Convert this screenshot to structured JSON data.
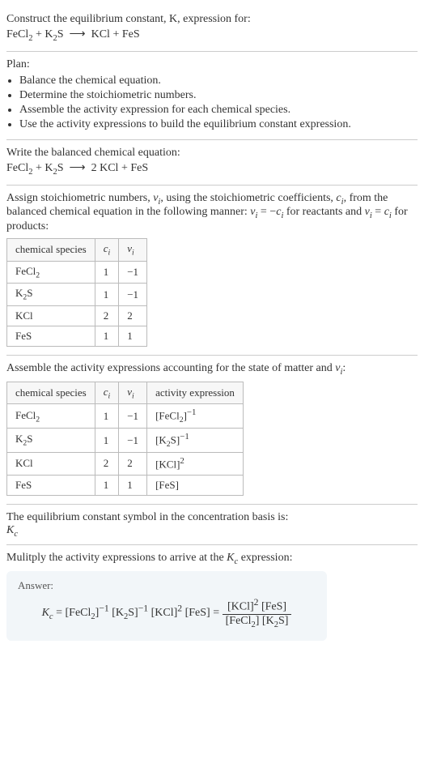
{
  "prompt": {
    "line1": "Construct the equilibrium constant, K, expression for:",
    "equation_unbalanced_html": "FeCl<sub>2</sub> + K<sub>2</sub>S &nbsp;⟶&nbsp; KCl + FeS"
  },
  "plan": {
    "heading": "Plan:",
    "items": [
      "Balance the chemical equation.",
      "Determine the stoichiometric numbers.",
      "Assemble the activity expression for each chemical species.",
      "Use the activity expressions to build the equilibrium constant expression."
    ]
  },
  "balanced": {
    "heading": "Write the balanced chemical equation:",
    "equation_html": "FeCl<sub>2</sub> + K<sub>2</sub>S &nbsp;⟶&nbsp; 2 KCl + FeS"
  },
  "stoich": {
    "intro_html": "Assign stoichiometric numbers, <i>ν<sub>i</sub></i>, using the stoichiometric coefficients, <i>c<sub>i</sub></i>, from the balanced chemical equation in the following manner: <i>ν<sub>i</sub></i> = −<i>c<sub>i</sub></i> for reactants and <i>ν<sub>i</sub></i> = <i>c<sub>i</sub></i> for products:",
    "headers": [
      "chemical species",
      "<i>c<sub>i</sub></i>",
      "<i>ν<sub>i</sub></i>"
    ],
    "rows": [
      [
        "FeCl<sub>2</sub>",
        "1",
        "−1"
      ],
      [
        "K<sub>2</sub>S",
        "1",
        "−1"
      ],
      [
        "KCl",
        "2",
        "2"
      ],
      [
        "FeS",
        "1",
        "1"
      ]
    ]
  },
  "activity": {
    "intro_html": "Assemble the activity expressions accounting for the state of matter and <i>ν<sub>i</sub></i>:",
    "headers": [
      "chemical species",
      "<i>c<sub>i</sub></i>",
      "<i>ν<sub>i</sub></i>",
      "activity expression"
    ],
    "rows": [
      [
        "FeCl<sub>2</sub>",
        "1",
        "−1",
        "[FeCl<sub>2</sub>]<sup>−1</sup>"
      ],
      [
        "K<sub>2</sub>S",
        "1",
        "−1",
        "[K<sub>2</sub>S]<sup>−1</sup>"
      ],
      [
        "KCl",
        "2",
        "2",
        "[KCl]<sup>2</sup>"
      ],
      [
        "FeS",
        "1",
        "1",
        "[FeS]"
      ]
    ]
  },
  "symbol": {
    "line1": "The equilibrium constant symbol in the concentration basis is:",
    "line2_html": "<i>K<sub>c</sub></i>"
  },
  "multiply": {
    "line_html": "Mulitply the activity expressions to arrive at the <i>K<sub>c</sub></i> expression:"
  },
  "answer": {
    "label": "Answer:",
    "lhs_html": "<i>K<sub>c</sub></i> = [FeCl<sub>2</sub>]<sup>−1</sup> [K<sub>2</sub>S]<sup>−1</sup> [KCl]<sup>2</sup> [FeS] = ",
    "frac_num_html": "[KCl]<sup>2</sup> [FeS]",
    "frac_den_html": "[FeCl<sub>2</sub>] [K<sub>2</sub>S]"
  },
  "chart_data": {
    "type": "table",
    "tables": [
      {
        "title": "Stoichiometric numbers",
        "columns": [
          "chemical species",
          "c_i",
          "ν_i"
        ],
        "rows": [
          {
            "chemical species": "FeCl2",
            "c_i": 1,
            "ν_i": -1
          },
          {
            "chemical species": "K2S",
            "c_i": 1,
            "ν_i": -1
          },
          {
            "chemical species": "KCl",
            "c_i": 2,
            "ν_i": 2
          },
          {
            "chemical species": "FeS",
            "c_i": 1,
            "ν_i": 1
          }
        ]
      },
      {
        "title": "Activity expressions",
        "columns": [
          "chemical species",
          "c_i",
          "ν_i",
          "activity expression"
        ],
        "rows": [
          {
            "chemical species": "FeCl2",
            "c_i": 1,
            "ν_i": -1,
            "activity expression": "[FeCl2]^-1"
          },
          {
            "chemical species": "K2S",
            "c_i": 1,
            "ν_i": -1,
            "activity expression": "[K2S]^-1"
          },
          {
            "chemical species": "KCl",
            "c_i": 2,
            "ν_i": 2,
            "activity expression": "[KCl]^2"
          },
          {
            "chemical species": "FeS",
            "c_i": 1,
            "ν_i": 1,
            "activity expression": "[FeS]"
          }
        ]
      }
    ]
  }
}
